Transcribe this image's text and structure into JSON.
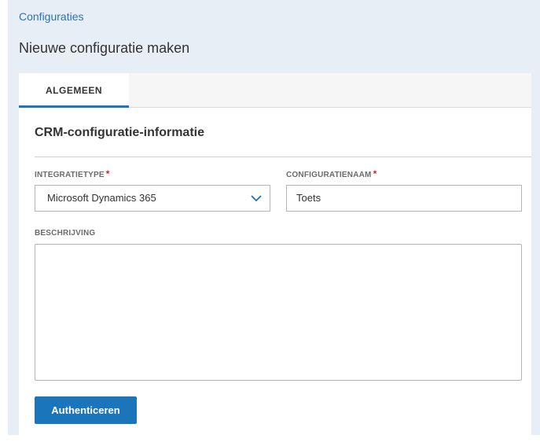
{
  "header": {
    "breadcrumb": "Configuraties",
    "title": "Nieuwe configuratie maken"
  },
  "tabs": [
    {
      "label": "ALGEMEEN",
      "active": true
    }
  ],
  "section": {
    "title": "CRM-configuratie-informatie"
  },
  "form": {
    "integration_type": {
      "label": "INTEGRATIETYPE",
      "required_marker": "*",
      "value": "Microsoft Dynamics 365"
    },
    "configuration_name": {
      "label": "CONFIGURATIENAAM",
      "required_marker": "*",
      "value": "Toets"
    },
    "description": {
      "label": "BESCHRIJVING",
      "value": ""
    },
    "submit_label": "Authenticeren"
  },
  "colors": {
    "accent": "#1b75bb",
    "header_background": "#e8eef6",
    "required": "#d6202f"
  },
  "icons": {
    "select_chevron": "chevron-down-icon"
  }
}
